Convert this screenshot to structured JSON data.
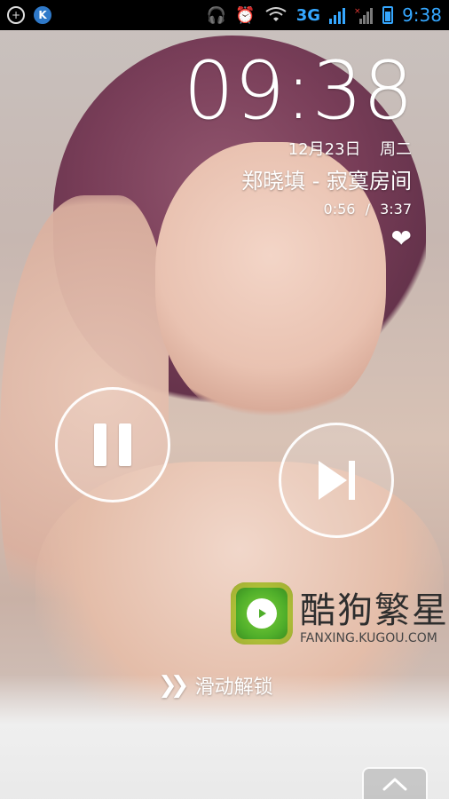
{
  "status_bar": {
    "left_icons": [
      "add-circle-icon",
      "k-app-icon"
    ],
    "right_icons": [
      "headset-icon",
      "alarm-icon",
      "wifi-icon",
      "3g-signal-icon",
      "no-signal-icon",
      "battery-icon"
    ],
    "network_label": "3G",
    "time": "9:38",
    "accent_color": "#35a7ff"
  },
  "lockscreen": {
    "clock": "09:38",
    "date": "12月23日",
    "weekday": "周二",
    "song_title": "郑晓填 - 寂寞房间",
    "elapsed": "0:56",
    "separator": "/",
    "duration": "3:37",
    "favorite_icon": "heart-icon"
  },
  "controls": {
    "pause_icon": "pause-icon",
    "next_icon": "skip-next-icon"
  },
  "watermark": {
    "name": "酷狗繁星",
    "url": "FANXING.KUGOU.COM"
  },
  "unlock": {
    "label": "滑动解锁",
    "chevrons": "❯❯"
  },
  "bottom": {
    "up_icon": "chevron-up-icon"
  }
}
